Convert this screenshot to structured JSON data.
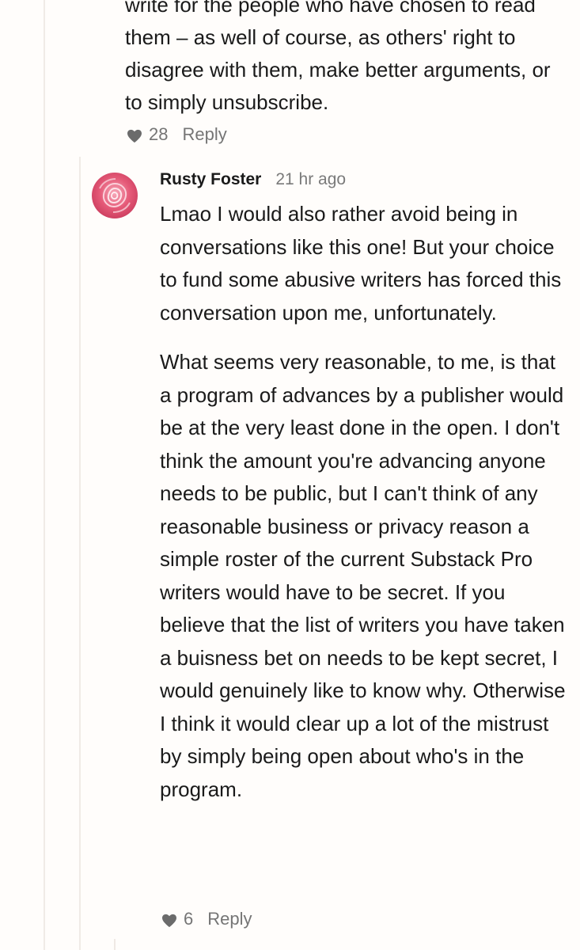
{
  "parent_comment": {
    "paragraph": "write for the people who have chosen to read them – as well of course, as others' right to disagree with them, make better arguments, or to simply unsubscribe.",
    "likes": "28",
    "reply_label": "Reply"
  },
  "reply_comment": {
    "author": "Rusty Foster",
    "timestamp": "21 hr ago",
    "paragraphs": [
      "Lmao I would also rather avoid being in conversations like this one! But your choice to fund some abusive writers has forced this conversation upon me, unfortunately.",
      "What seems very reasonable, to me, is that a program of advances by a publisher would be at the very least done in the open. I don't think the amount you're advancing anyone needs to be public, but I can't think of any reasonable business or privacy reason a simple roster of the current Substack Pro writers would have to be secret. If you believe that the list of writers you have taken a buisness bet on needs to be kept secret, I would genuinely like to know why. Otherwise I think it would clear up a lot of the mistrust by simply being open about who's in the program."
    ],
    "likes": "6",
    "reply_label": "Reply"
  },
  "icons": {
    "like": "heart-icon",
    "avatar": "rose-avatar"
  },
  "colors": {
    "heart": "#6b6b6b",
    "meta_text": "#757575",
    "thread_line": "#f0ebe6",
    "avatar_pink": "#e55a78"
  }
}
